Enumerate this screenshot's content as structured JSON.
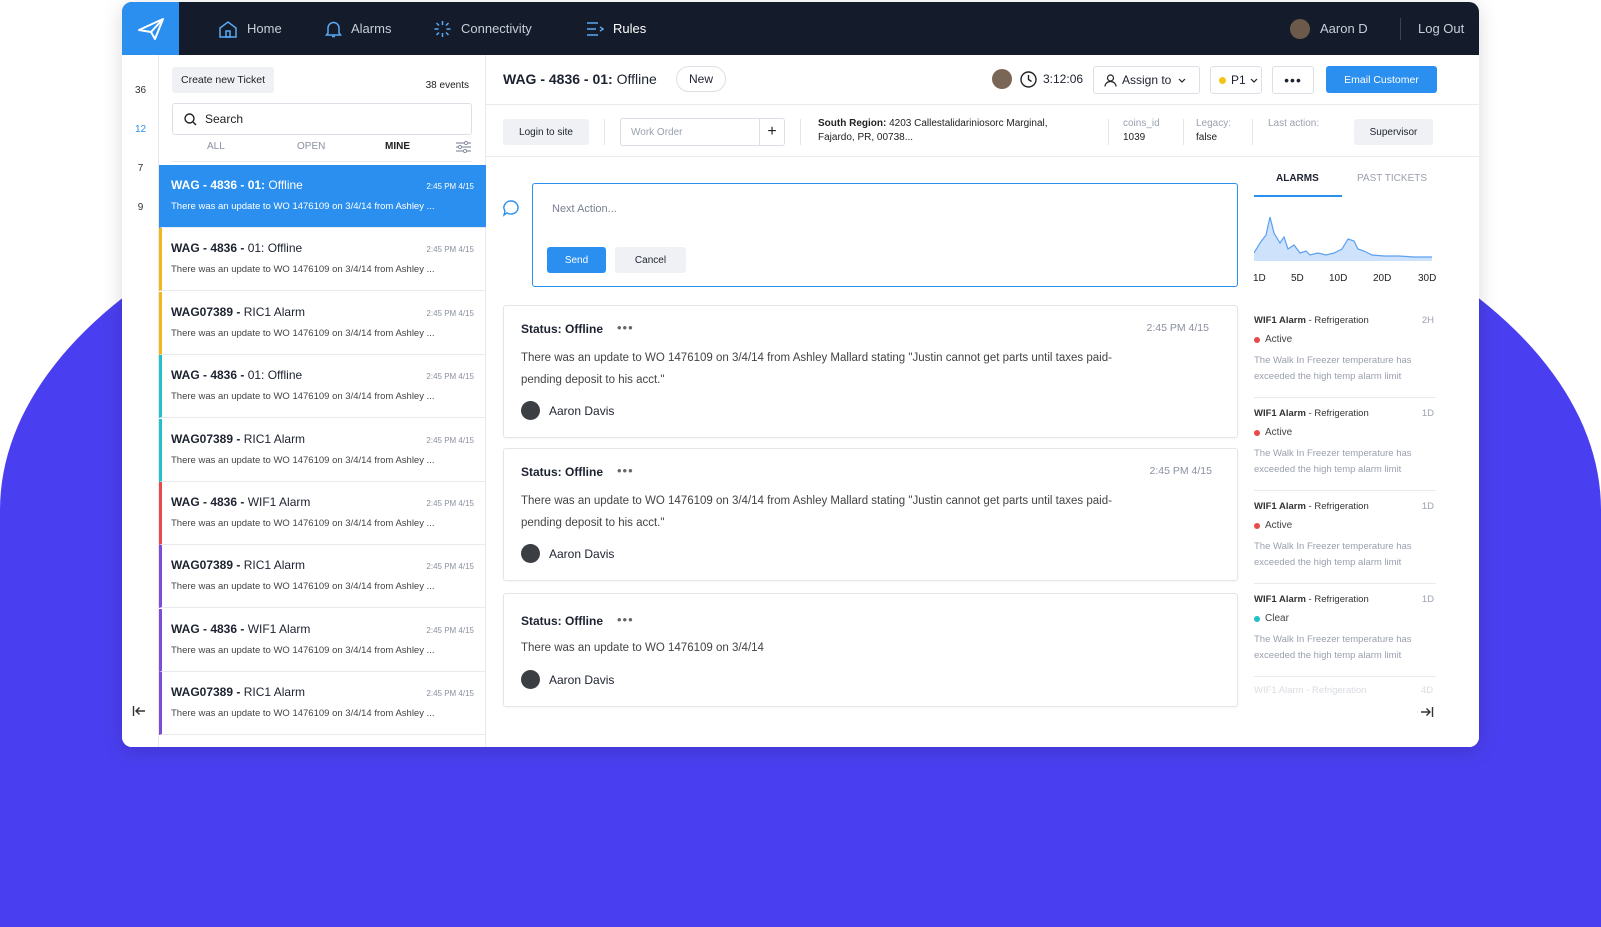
{
  "nav": {
    "items": [
      {
        "label": "Home",
        "icon": "home-icon"
      },
      {
        "label": "Alarms",
        "icon": "bell-icon"
      },
      {
        "label": "Connectivity",
        "icon": "spinner-icon"
      },
      {
        "label": "Rules",
        "icon": "rules-icon"
      }
    ],
    "user_name": "Aaron D",
    "logout_label": "Log Out"
  },
  "rail": {
    "counts": [
      "36",
      "12",
      "7",
      "9"
    ]
  },
  "list": {
    "create_label": "Create new Ticket",
    "events_label": "38 events",
    "search_placeholder": "Search",
    "tabs": [
      "ALL",
      "OPEN",
      "MINE"
    ],
    "tickets": [
      {
        "title_bold": "WAG - 4836 - 01:",
        "title_rest": " Offline",
        "time": "2:45 PM 4/15",
        "body": "There was an update to WO 1476109 on 3/4/14 from Ashley ...",
        "color": "#2b8ff0"
      },
      {
        "title_bold": "WAG - 4836 -",
        "title_rest": " 01: Offline",
        "time": "2:45 PM 4/15",
        "body": "There was an update to WO 1476109 on 3/4/14 from Ashley ...",
        "color": "#f2b51a"
      },
      {
        "title_bold": "WAG07389 -",
        "title_rest": " RIC1 Alarm",
        "time": "2:45 PM 4/15",
        "body": "There was an update to WO 1476109 on 3/4/14 from Ashley ...",
        "color": "#f2b51a"
      },
      {
        "title_bold": "WAG - 4836 -",
        "title_rest": " 01: Offline",
        "time": "2:45 PM 4/15",
        "body": "There was an update to WO 1476109 on 3/4/14 from Ashley ...",
        "color": "#1fc0c8"
      },
      {
        "title_bold": "WAG07389 -",
        "title_rest": " RIC1 Alarm",
        "time": "2:45 PM 4/15",
        "body": "There was an update to WO 1476109 on 3/4/14 from Ashley ...",
        "color": "#1fc0c8"
      },
      {
        "title_bold": "WAG - 4836 -",
        "title_rest": " WIF1 Alarm",
        "time": "2:45 PM 4/15",
        "body": "There was an update to WO 1476109 on 3/4/14 from Ashley ...",
        "color": "#e84a4a"
      },
      {
        "title_bold": "WAG07389 -",
        "title_rest": " RIC1 Alarm",
        "time": "2:45 PM 4/15",
        "body": "There was an update to WO 1476109 on 3/4/14 from Ashley ...",
        "color": "#7c4ed8"
      },
      {
        "title_bold": "WAG - 4836 -",
        "title_rest": " WIF1 Alarm",
        "time": "2:45 PM 4/15",
        "body": "There was an update to WO 1476109 on 3/4/14 from Ashley ...",
        "color": "#7c4ed8"
      },
      {
        "title_bold": "WAG07389 -",
        "title_rest": " RIC1 Alarm",
        "time": "2:45 PM 4/15",
        "body": "There was an update to WO 1476109 on 3/4/14 from Ashley ...",
        "color": "#7c4ed8"
      }
    ]
  },
  "header": {
    "title_bold": "WAG - 4836 - 01:",
    "title_rest": " Offline",
    "badge": "New",
    "timer": "3:12:06",
    "assign_label": "Assign to",
    "priority": "P1",
    "more": "•••",
    "email_label": "Email Customer"
  },
  "info": {
    "login_label": "Login to site",
    "work_order_placeholder": "Work Order",
    "plus": "+",
    "region_label": "South Region:",
    "region_address": " 4203 Callestalidariniosorc Marginal, Fajardo, PR, 00738...",
    "coins_key": "coins_id",
    "coins_val": "1039",
    "legacy_key": "Legacy:",
    "legacy_val": "false",
    "last_action_key": "Last action:",
    "supervisor_label": "Supervisor"
  },
  "compose": {
    "placeholder": "Next Action...",
    "send_label": "Send",
    "cancel_label": "Cancel"
  },
  "updates": [
    {
      "status": "Status: Offline",
      "dots": "•••",
      "time": "2:45 PM 4/15",
      "body": "There was an update to WO 1476109 on 3/4/14 from Ashley Mallard stating \"Justin cannot get parts until taxes paid-pending deposit to his acct.\"",
      "author": "Aaron Davis"
    },
    {
      "status": "Status: Offline",
      "dots": "•••",
      "time": "2:45 PM 4/15",
      "body": "There was an update to WO 1476109 on 3/4/14 from Ashley Mallard stating \"Justin cannot get parts until taxes paid-pending deposit to his acct.\"",
      "author": "Aaron Davis"
    },
    {
      "status": "Status: Offline",
      "dots": "•••",
      "time": "",
      "body": "There was an update to WO 1476109 on 3/4/14",
      "author": "Aaron Davis"
    }
  ],
  "right": {
    "tabs": [
      "ALARMS",
      "PAST TICKETS"
    ],
    "ranges": [
      "1D",
      "5D",
      "10D",
      "20D",
      "30D"
    ],
    "alarms": [
      {
        "title_bold": "WIF1 Alarm",
        "title_rest": " - Refrigeration",
        "age": "2H",
        "status": "Active",
        "status_color": "#e84a4a",
        "desc": "The Walk In Freezer temperature has exceeded the high temp alarm limit"
      },
      {
        "title_bold": "WIF1 Alarm",
        "title_rest": " - Refrigeration",
        "age": "1D",
        "status": "Active",
        "status_color": "#e84a4a",
        "desc": "The Walk In Freezer temperature has exceeded the high temp alarm limit"
      },
      {
        "title_bold": "WIF1 Alarm",
        "title_rest": " - Refrigeration",
        "age": "1D",
        "status": "Active",
        "status_color": "#e84a4a",
        "desc": "The Walk In Freezer temperature has exceeded the high temp alarm limit"
      },
      {
        "title_bold": "WIF1 Alarm",
        "title_rest": " - Refrigeration",
        "age": "1D",
        "status": "Clear",
        "status_color": "#1fc0c8",
        "desc": "The Walk In Freezer temperature has exceeded the high temp alarm limit"
      }
    ],
    "faded_item": "WIF1 Alarm - Refrigeration",
    "faded_age": "4D"
  }
}
